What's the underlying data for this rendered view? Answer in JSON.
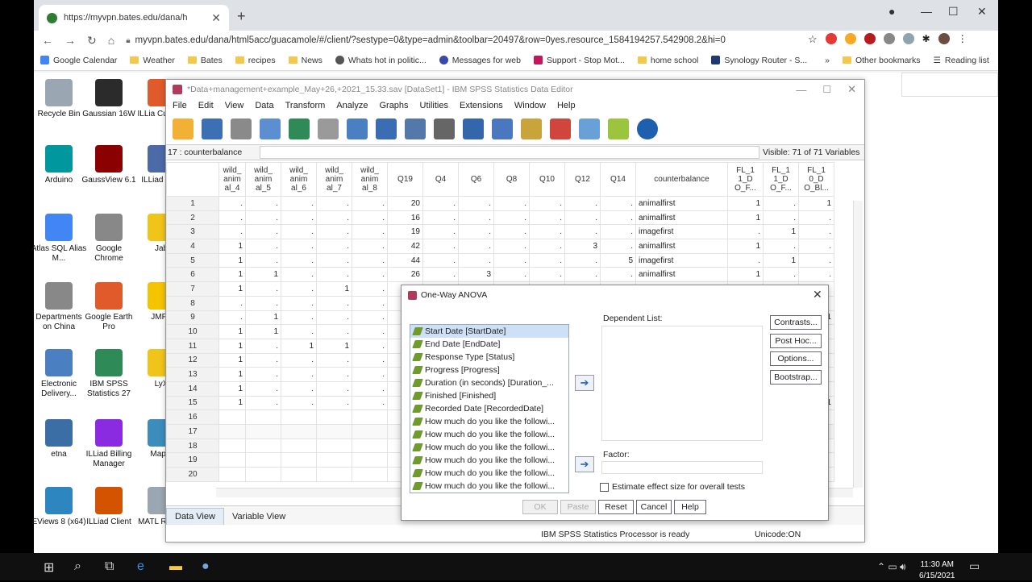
{
  "browser": {
    "tab_title": "https://myvpn.bates.edu/dana/h",
    "url": "myvpn.bates.edu/dana/html5acc/guacamole/#/client/?sestype=0&type=admin&toolbar=20497&row=0yes.resource_1584194257.542908.2&hi=0",
    "bookmarks": [
      "Google Calendar",
      "Weather",
      "Bates",
      "recipes",
      "News",
      "Whats hot in politic...",
      "Messages for web",
      "Support - Stop Mot...",
      "home school",
      "Synology Router - S..."
    ],
    "other_bookmarks": "Other bookmarks",
    "reading_list": "Reading list"
  },
  "desktop": {
    "icons": [
      {
        "label": "Recycle Bin"
      },
      {
        "label": "Gaussian 16W"
      },
      {
        "label": "ILLia Custom"
      },
      {
        "label": "Arduino"
      },
      {
        "label": "GaussView 6.1"
      },
      {
        "label": "ILLiad Man"
      },
      {
        "label": "Atlas SQL Alias M..."
      },
      {
        "label": "Google Chrome"
      },
      {
        "label": "Jab"
      },
      {
        "label": "Departments on China"
      },
      {
        "label": "Google Earth Pro"
      },
      {
        "label": "JMP I"
      },
      {
        "label": "Electronic Delivery..."
      },
      {
        "label": "IBM SPSS Statistics 27"
      },
      {
        "label": "LyX"
      },
      {
        "label": "etna"
      },
      {
        "label": "ILLiad Billing Manager"
      },
      {
        "label": "Maple"
      },
      {
        "label": "EViews 8 (x64)"
      },
      {
        "label": "ILLiad Client"
      },
      {
        "label": "MATL R2020"
      }
    ]
  },
  "spss": {
    "title": "*Data+management+example_May+26,+2021_15.33.sav [DataSet1] - IBM SPSS Statistics Data Editor",
    "menu": [
      "File",
      "Edit",
      "View",
      "Data",
      "Transform",
      "Analyze",
      "Graphs",
      "Utilities",
      "Extensions",
      "Window",
      "Help"
    ],
    "cell_ref": "17 : counterbalance",
    "visible": "Visible: 71 of 71 Variables",
    "columns": [
      "wild_\nanim\nal_4",
      "wild_\nanim\nal_5",
      "wild_\nanim\nal_6",
      "wild_\nanim\nal_7",
      "wild_\nanim\nal_8",
      "Q19",
      "Q4",
      "Q6",
      "Q8",
      "Q10",
      "Q12",
      "Q14",
      "counterbalance",
      "FL_1\n1_D\nO_F...",
      "FL_1\n1_D\nO_F...",
      "FL_1\n0_D\nO_Bl..."
    ],
    "rows": [
      [
        "1",
        ".",
        ".",
        ".",
        ".",
        ".",
        "20",
        ".",
        ".",
        ".",
        ".",
        ".",
        ".",
        "animalfirst",
        "1",
        ".",
        "1"
      ],
      [
        "2",
        ".",
        ".",
        ".",
        ".",
        ".",
        "16",
        ".",
        ".",
        ".",
        ".",
        ".",
        ".",
        "animalfirst",
        "1",
        ".",
        "."
      ],
      [
        "3",
        ".",
        ".",
        ".",
        ".",
        ".",
        "19",
        ".",
        ".",
        ".",
        ".",
        ".",
        ".",
        "imagefirst",
        ".",
        "1",
        "."
      ],
      [
        "4",
        "1",
        ".",
        ".",
        ".",
        ".",
        "42",
        ".",
        ".",
        ".",
        ".",
        "3",
        ".",
        "animalfirst",
        "1",
        ".",
        "."
      ],
      [
        "5",
        "1",
        ".",
        ".",
        ".",
        ".",
        "44",
        ".",
        ".",
        ".",
        ".",
        ".",
        "5",
        "imagefirst",
        ".",
        "1",
        "."
      ],
      [
        "6",
        "1",
        "1",
        ".",
        ".",
        ".",
        "26",
        ".",
        "3",
        ".",
        ".",
        ".",
        ".",
        "animalfirst",
        "1",
        ".",
        "."
      ],
      [
        "7",
        "1",
        ".",
        ".",
        "1",
        ".",
        "",
        "",
        "",
        "",
        "",
        "",
        "",
        "",
        "",
        "",
        ""
      ],
      [
        "8",
        ".",
        ".",
        ".",
        ".",
        ".",
        "",
        "",
        "",
        "",
        "",
        "",
        "",
        "",
        "",
        "",
        ""
      ],
      [
        "9",
        ".",
        "1",
        ".",
        ".",
        ".",
        "",
        "",
        "",
        "",
        "",
        "",
        "",
        "",
        "",
        "",
        "1"
      ],
      [
        "10",
        "1",
        "1",
        ".",
        ".",
        ".",
        "",
        "",
        "",
        "",
        "",
        "",
        "",
        "",
        "",
        "",
        ""
      ],
      [
        "11",
        "1",
        ".",
        "1",
        "1",
        ".",
        "",
        "",
        "",
        "",
        "",
        "",
        "",
        "",
        "",
        "",
        ""
      ],
      [
        "12",
        "1",
        ".",
        ".",
        ".",
        ".",
        "",
        "",
        "",
        "",
        "",
        "",
        "",
        "",
        "",
        "",
        ""
      ],
      [
        "13",
        "1",
        ".",
        ".",
        ".",
        ".",
        "",
        "",
        "",
        "",
        "",
        "",
        "",
        "",
        "",
        "",
        ""
      ],
      [
        "14",
        "1",
        ".",
        ".",
        ".",
        ".",
        "",
        "",
        "",
        "",
        "",
        "",
        "",
        "",
        "",
        "",
        ""
      ],
      [
        "15",
        "1",
        ".",
        ".",
        ".",
        ".",
        "",
        "",
        "",
        "",
        "",
        "",
        "",
        "",
        "",
        "",
        "1"
      ],
      [
        "16",
        "",
        "",
        "",
        "",
        "",
        "",
        "",
        "",
        "",
        "",
        "",
        "",
        "",
        "",
        "",
        ""
      ],
      [
        "17",
        "",
        "",
        "",
        "",
        "",
        "",
        "",
        "",
        "",
        "",
        "",
        "",
        "",
        "",
        "",
        ""
      ],
      [
        "18",
        "",
        "",
        "",
        "",
        "",
        "",
        "",
        "",
        "",
        "",
        "",
        "",
        "",
        "",
        "",
        ""
      ],
      [
        "19",
        "",
        "",
        "",
        "",
        "",
        "",
        "",
        "",
        "",
        "",
        "",
        "",
        "",
        "",
        "",
        ""
      ],
      [
        "20",
        "",
        "",
        "",
        "",
        "",
        "",
        "",
        "",
        "",
        "",
        "",
        "",
        "",
        "",
        "",
        ""
      ]
    ],
    "tabs": [
      "Data View",
      "Variable View"
    ],
    "status": "IBM SPSS Statistics Processor is ready",
    "unicode": "Unicode:ON"
  },
  "dialog": {
    "title": "One-Way ANOVA",
    "variables": [
      "Start Date [StartDate]",
      "End Date [EndDate]",
      "Response Type [Status]",
      "Progress [Progress]",
      "Duration (in seconds) [Duration_...",
      "Finished [Finished]",
      "Recorded Date [RecordedDate]",
      "How much do you like the followi...",
      "How much do you like the followi...",
      "How much do you like the followi...",
      "How much do you like the followi...",
      "How much do you like the followi...",
      "How much do you like the followi..."
    ],
    "dependent_label": "Dependent List:",
    "factor_label": "Factor:",
    "side_buttons": [
      "Contrasts...",
      "Post Hoc...",
      "Options...",
      "Bootstrap..."
    ],
    "estimate_label": "Estimate effect size for overall tests",
    "bottom_buttons": [
      "OK",
      "Paste",
      "Reset",
      "Cancel",
      "Help"
    ]
  },
  "taskbar": {
    "time": "11:30 AM",
    "date": "6/15/2021"
  }
}
